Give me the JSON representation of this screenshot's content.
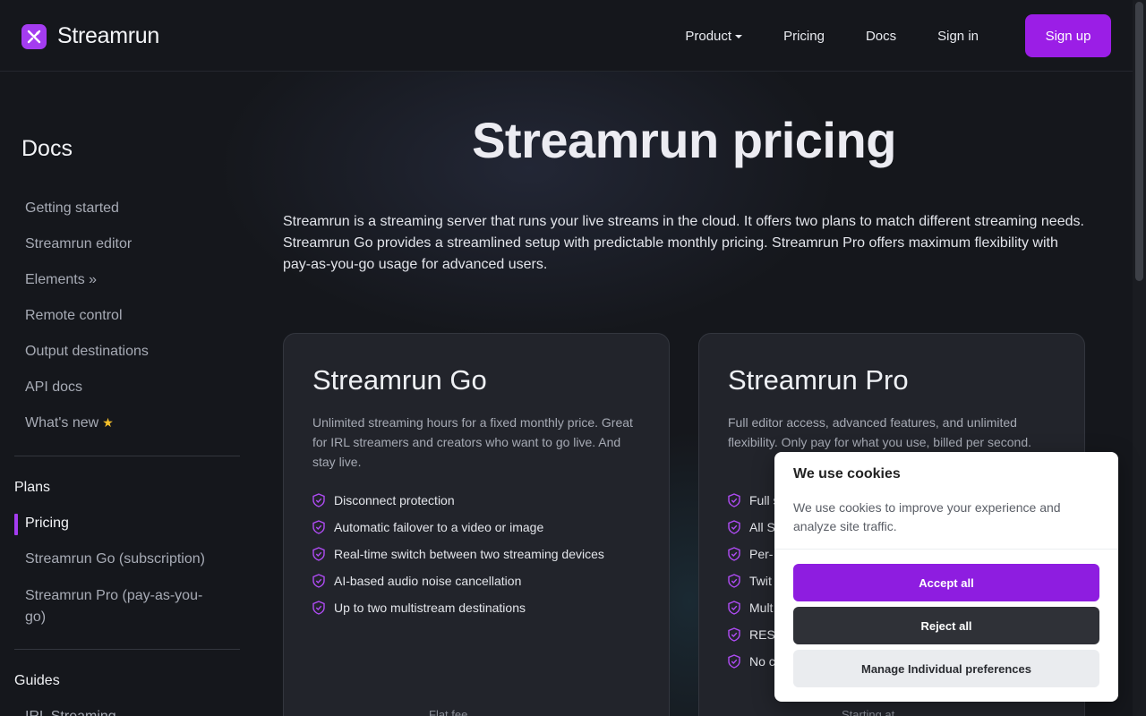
{
  "header": {
    "brand": "Streamrun",
    "nav": {
      "product": "Product",
      "pricing": "Pricing",
      "docs": "Docs",
      "signin": "Sign in",
      "signup": "Sign up"
    }
  },
  "sidebar": {
    "title": "Docs",
    "items": {
      "getting_started": "Getting started",
      "editor": "Streamrun editor",
      "elements": "Elements »",
      "remote": "Remote control",
      "output": "Output destinations",
      "api": "API docs",
      "whats_new": "What's new"
    },
    "plans": {
      "heading": "Plans",
      "pricing": "Pricing",
      "go": "Streamrun Go (subscription)",
      "pro_line1": "Streamrun Pro (pay-as-you-",
      "pro_line2": "go)"
    },
    "guides": {
      "heading": "Guides",
      "irl": "IRL Streaming"
    }
  },
  "main": {
    "title": "Streamrun pricing",
    "intro": "Streamrun is a streaming server that runs your live streams in the cloud. It offers two plans to match different streaming needs. Streamrun Go provides a streamlined setup with predictable monthly pricing. Streamrun Pro offers maximum flexibility with pay-as-you-go usage for advanced users.",
    "plans": {
      "go": {
        "title": "Streamrun Go",
        "desc": "Unlimited streaming hours for a fixed monthly price. Great for IRL streamers and creators who want to go live. And stay live.",
        "features": [
          "Disconnect protection",
          "Automatic failover to a video or image",
          "Real-time switch between two streaming devices",
          "AI-based audio noise cancellation",
          "Up to two multistream destinations"
        ],
        "footer": "Flat fee"
      },
      "pro": {
        "title": "Streamrun Pro",
        "desc": "Full editor access, advanced features, and unlimited flexibility. Only pay for what you use, billed per second.",
        "features": [
          "Full s",
          "All S",
          "Per-",
          "Twit",
          "Mult",
          "REST",
          "No c"
        ],
        "footer": "Starting at"
      }
    }
  },
  "cookie": {
    "title": "We use cookies",
    "desc": "We use cookies to improve your experience and analyze site traffic.",
    "accept": "Accept all",
    "reject": "Reject all",
    "manage": "Manage Individual preferences"
  },
  "colors": {
    "accent": "#9b1ee6",
    "background": "#15171c",
    "card": "#22242b"
  }
}
